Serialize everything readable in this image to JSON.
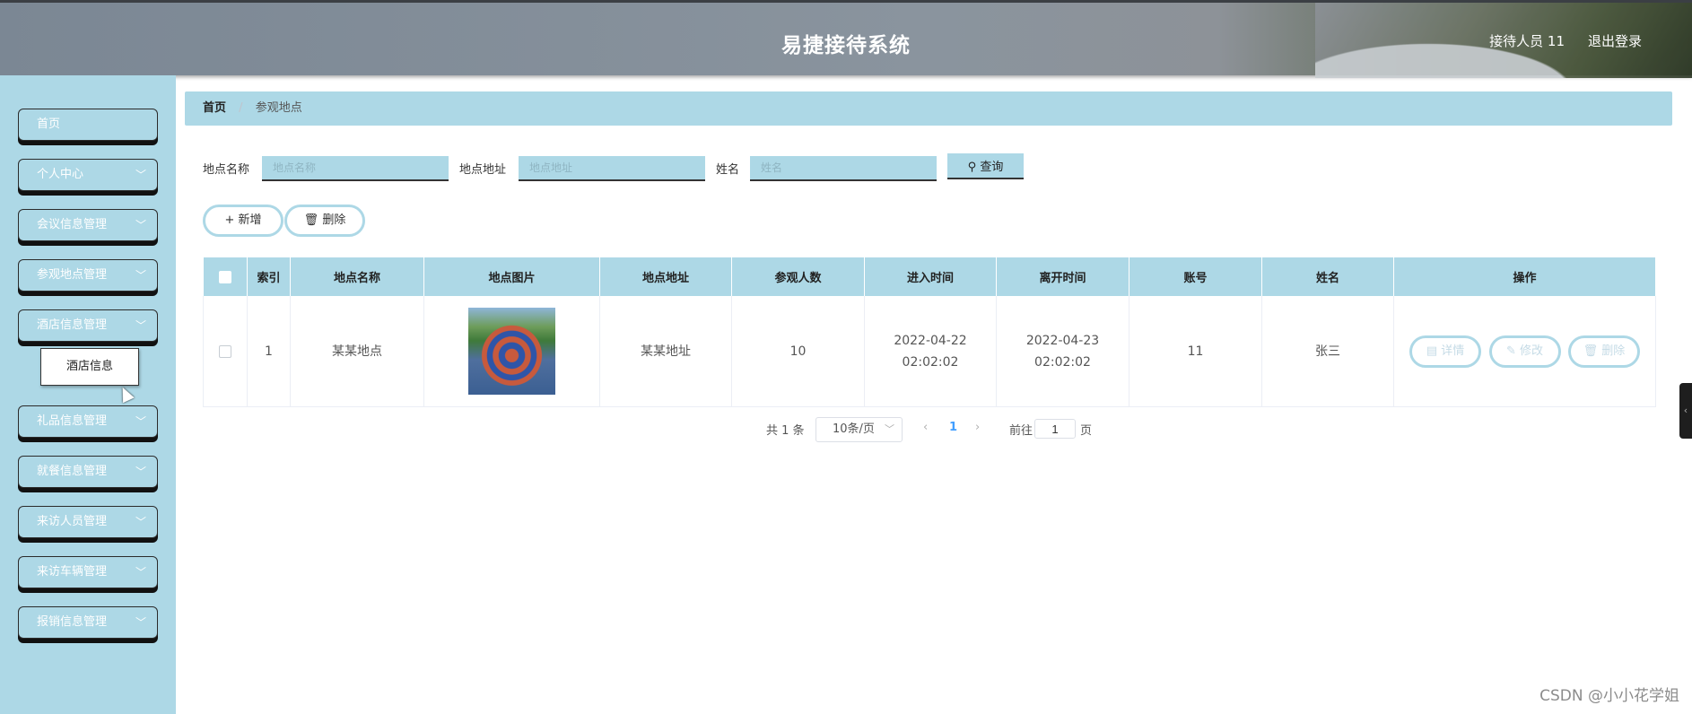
{
  "header": {
    "title": "易捷接待系统",
    "user": "接待人员 11",
    "logout": "退出登录"
  },
  "sidebar": {
    "items": [
      {
        "label": "首页",
        "chevron": ""
      },
      {
        "label": "个人中心",
        "chevron": "﹀"
      },
      {
        "label": "会议信息管理",
        "chevron": "﹀"
      },
      {
        "label": "参观地点管理",
        "chevron": "﹀"
      },
      {
        "label": "酒店信息管理",
        "chevron": "﹀"
      },
      {
        "label": "礼品信息管理",
        "chevron": "﹀"
      },
      {
        "label": "就餐信息管理",
        "chevron": "﹀"
      },
      {
        "label": "来访人员管理",
        "chevron": "﹀"
      },
      {
        "label": "来访车辆管理",
        "chevron": "﹀"
      },
      {
        "label": "报销信息管理",
        "chevron": "﹀"
      }
    ],
    "submenu_open": "酒店信息"
  },
  "breadcrumb": {
    "home": "首页",
    "separator": "/",
    "current": "参观地点"
  },
  "search": {
    "name_label": "地点名称",
    "name_placeholder": "地点名称",
    "address_label": "地点地址",
    "address_placeholder": "地点地址",
    "person_label": "姓名",
    "person_placeholder": "姓名",
    "query_button": "查询",
    "query_icon": "search-icon"
  },
  "actions": {
    "add": "新增",
    "add_icon": "plus-icon",
    "delete": "删除",
    "delete_icon": "trash-icon"
  },
  "table": {
    "columns": [
      "索引",
      "地点名称",
      "地点图片",
      "地点地址",
      "参观人数",
      "进入时间",
      "离开时间",
      "账号",
      "姓名",
      "操作"
    ],
    "rows": [
      {
        "index": "1",
        "name": "某某地点",
        "image": "playground-image",
        "address": "某某地址",
        "visitors": "10",
        "enter_time": "2022-04-22 02:02:02",
        "leave_time": "2022-04-23 02:02:02",
        "account": "11",
        "person": "张三",
        "ops": {
          "detail": "详情",
          "edit": "修改",
          "delete": "删除"
        }
      }
    ]
  },
  "pagination": {
    "total": "共 1 条",
    "page_size": "10条/页",
    "prev": "‹",
    "current_page": "1",
    "next": "›",
    "goto_label": "前往",
    "goto_value": "1",
    "page_unit": "页"
  },
  "watermark": "CSDN @小小花学姐",
  "colors": {
    "accent": "#add8e6",
    "page_active": "#409eff"
  }
}
